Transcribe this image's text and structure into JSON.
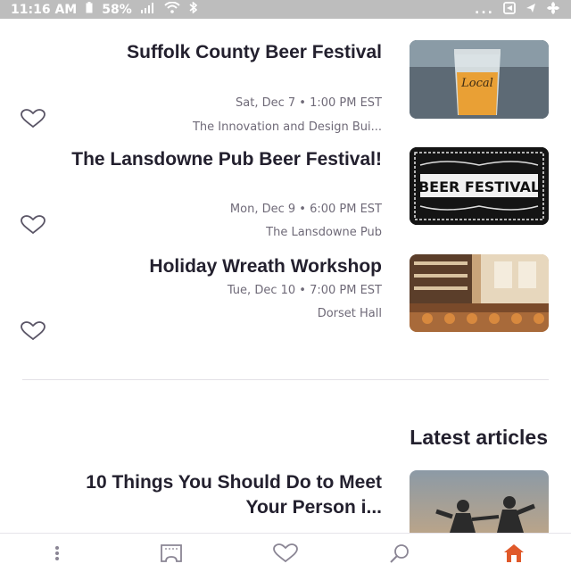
{
  "status_bar": {
    "time": "11:16 AM",
    "battery": "58%",
    "overflow": "..."
  },
  "events": [
    {
      "title": "Suffolk County Beer Festival",
      "date": "Sat, Dec 7 • 1:00 PM EST",
      "venue": "The Innovation and Design Bui...",
      "thumb_text": "Local"
    },
    {
      "title": "The Lansdowne Pub Beer Festival!",
      "date": "Mon, Dec 9 • 6:00 PM EST",
      "venue": "The Lansdowne Pub",
      "thumb_text": "BEER FESTIVAL"
    },
    {
      "title": "Holiday Wreath Workshop",
      "date": "Tue, Dec 10 • 7:00 PM EST",
      "venue": "Dorset Hall",
      "thumb_text": ""
    }
  ],
  "latest_articles": {
    "heading": "Latest articles",
    "items": [
      {
        "title": "10 Things You Should Do to Meet Your Person i..."
      }
    ]
  },
  "nav": {
    "items": [
      {
        "icon": "more-dots-icon"
      },
      {
        "icon": "tickets-icon"
      },
      {
        "icon": "heart-icon"
      },
      {
        "icon": "search-icon"
      },
      {
        "icon": "home-icon",
        "active": true
      }
    ],
    "active_color": "#e0592a"
  }
}
